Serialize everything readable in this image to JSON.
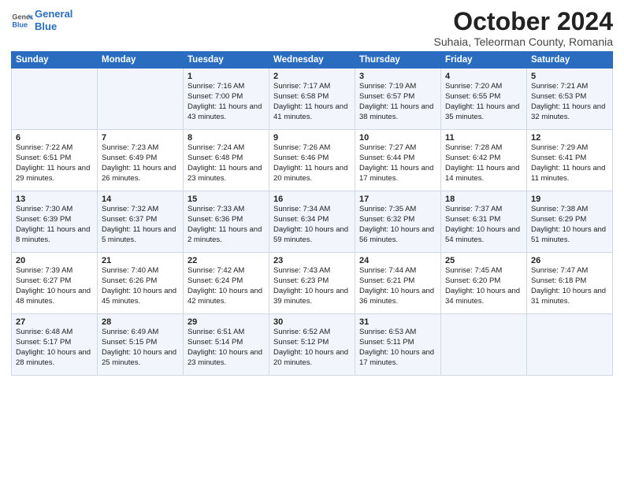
{
  "header": {
    "logo_line1": "General",
    "logo_line2": "Blue",
    "month_title": "October 2024",
    "subtitle": "Suhaia, Teleorman County, Romania"
  },
  "weekdays": [
    "Sunday",
    "Monday",
    "Tuesday",
    "Wednesday",
    "Thursday",
    "Friday",
    "Saturday"
  ],
  "weeks": [
    [
      {
        "num": "",
        "sunrise": "",
        "sunset": "",
        "daylight": ""
      },
      {
        "num": "",
        "sunrise": "",
        "sunset": "",
        "daylight": ""
      },
      {
        "num": "1",
        "sunrise": "Sunrise: 7:16 AM",
        "sunset": "Sunset: 7:00 PM",
        "daylight": "Daylight: 11 hours and 43 minutes."
      },
      {
        "num": "2",
        "sunrise": "Sunrise: 7:17 AM",
        "sunset": "Sunset: 6:58 PM",
        "daylight": "Daylight: 11 hours and 41 minutes."
      },
      {
        "num": "3",
        "sunrise": "Sunrise: 7:19 AM",
        "sunset": "Sunset: 6:57 PM",
        "daylight": "Daylight: 11 hours and 38 minutes."
      },
      {
        "num": "4",
        "sunrise": "Sunrise: 7:20 AM",
        "sunset": "Sunset: 6:55 PM",
        "daylight": "Daylight: 11 hours and 35 minutes."
      },
      {
        "num": "5",
        "sunrise": "Sunrise: 7:21 AM",
        "sunset": "Sunset: 6:53 PM",
        "daylight": "Daylight: 11 hours and 32 minutes."
      }
    ],
    [
      {
        "num": "6",
        "sunrise": "Sunrise: 7:22 AM",
        "sunset": "Sunset: 6:51 PM",
        "daylight": "Daylight: 11 hours and 29 minutes."
      },
      {
        "num": "7",
        "sunrise": "Sunrise: 7:23 AM",
        "sunset": "Sunset: 6:49 PM",
        "daylight": "Daylight: 11 hours and 26 minutes."
      },
      {
        "num": "8",
        "sunrise": "Sunrise: 7:24 AM",
        "sunset": "Sunset: 6:48 PM",
        "daylight": "Daylight: 11 hours and 23 minutes."
      },
      {
        "num": "9",
        "sunrise": "Sunrise: 7:26 AM",
        "sunset": "Sunset: 6:46 PM",
        "daylight": "Daylight: 11 hours and 20 minutes."
      },
      {
        "num": "10",
        "sunrise": "Sunrise: 7:27 AM",
        "sunset": "Sunset: 6:44 PM",
        "daylight": "Daylight: 11 hours and 17 minutes."
      },
      {
        "num": "11",
        "sunrise": "Sunrise: 7:28 AM",
        "sunset": "Sunset: 6:42 PM",
        "daylight": "Daylight: 11 hours and 14 minutes."
      },
      {
        "num": "12",
        "sunrise": "Sunrise: 7:29 AM",
        "sunset": "Sunset: 6:41 PM",
        "daylight": "Daylight: 11 hours and 11 minutes."
      }
    ],
    [
      {
        "num": "13",
        "sunrise": "Sunrise: 7:30 AM",
        "sunset": "Sunset: 6:39 PM",
        "daylight": "Daylight: 11 hours and 8 minutes."
      },
      {
        "num": "14",
        "sunrise": "Sunrise: 7:32 AM",
        "sunset": "Sunset: 6:37 PM",
        "daylight": "Daylight: 11 hours and 5 minutes."
      },
      {
        "num": "15",
        "sunrise": "Sunrise: 7:33 AM",
        "sunset": "Sunset: 6:36 PM",
        "daylight": "Daylight: 11 hours and 2 minutes."
      },
      {
        "num": "16",
        "sunrise": "Sunrise: 7:34 AM",
        "sunset": "Sunset: 6:34 PM",
        "daylight": "Daylight: 10 hours and 59 minutes."
      },
      {
        "num": "17",
        "sunrise": "Sunrise: 7:35 AM",
        "sunset": "Sunset: 6:32 PM",
        "daylight": "Daylight: 10 hours and 56 minutes."
      },
      {
        "num": "18",
        "sunrise": "Sunrise: 7:37 AM",
        "sunset": "Sunset: 6:31 PM",
        "daylight": "Daylight: 10 hours and 54 minutes."
      },
      {
        "num": "19",
        "sunrise": "Sunrise: 7:38 AM",
        "sunset": "Sunset: 6:29 PM",
        "daylight": "Daylight: 10 hours and 51 minutes."
      }
    ],
    [
      {
        "num": "20",
        "sunrise": "Sunrise: 7:39 AM",
        "sunset": "Sunset: 6:27 PM",
        "daylight": "Daylight: 10 hours and 48 minutes."
      },
      {
        "num": "21",
        "sunrise": "Sunrise: 7:40 AM",
        "sunset": "Sunset: 6:26 PM",
        "daylight": "Daylight: 10 hours and 45 minutes."
      },
      {
        "num": "22",
        "sunrise": "Sunrise: 7:42 AM",
        "sunset": "Sunset: 6:24 PM",
        "daylight": "Daylight: 10 hours and 42 minutes."
      },
      {
        "num": "23",
        "sunrise": "Sunrise: 7:43 AM",
        "sunset": "Sunset: 6:23 PM",
        "daylight": "Daylight: 10 hours and 39 minutes."
      },
      {
        "num": "24",
        "sunrise": "Sunrise: 7:44 AM",
        "sunset": "Sunset: 6:21 PM",
        "daylight": "Daylight: 10 hours and 36 minutes."
      },
      {
        "num": "25",
        "sunrise": "Sunrise: 7:45 AM",
        "sunset": "Sunset: 6:20 PM",
        "daylight": "Daylight: 10 hours and 34 minutes."
      },
      {
        "num": "26",
        "sunrise": "Sunrise: 7:47 AM",
        "sunset": "Sunset: 6:18 PM",
        "daylight": "Daylight: 10 hours and 31 minutes."
      }
    ],
    [
      {
        "num": "27",
        "sunrise": "Sunrise: 6:48 AM",
        "sunset": "Sunset: 5:17 PM",
        "daylight": "Daylight: 10 hours and 28 minutes."
      },
      {
        "num": "28",
        "sunrise": "Sunrise: 6:49 AM",
        "sunset": "Sunset: 5:15 PM",
        "daylight": "Daylight: 10 hours and 25 minutes."
      },
      {
        "num": "29",
        "sunrise": "Sunrise: 6:51 AM",
        "sunset": "Sunset: 5:14 PM",
        "daylight": "Daylight: 10 hours and 23 minutes."
      },
      {
        "num": "30",
        "sunrise": "Sunrise: 6:52 AM",
        "sunset": "Sunset: 5:12 PM",
        "daylight": "Daylight: 10 hours and 20 minutes."
      },
      {
        "num": "31",
        "sunrise": "Sunrise: 6:53 AM",
        "sunset": "Sunset: 5:11 PM",
        "daylight": "Daylight: 10 hours and 17 minutes."
      },
      {
        "num": "",
        "sunrise": "",
        "sunset": "",
        "daylight": ""
      },
      {
        "num": "",
        "sunrise": "",
        "sunset": "",
        "daylight": ""
      }
    ]
  ]
}
